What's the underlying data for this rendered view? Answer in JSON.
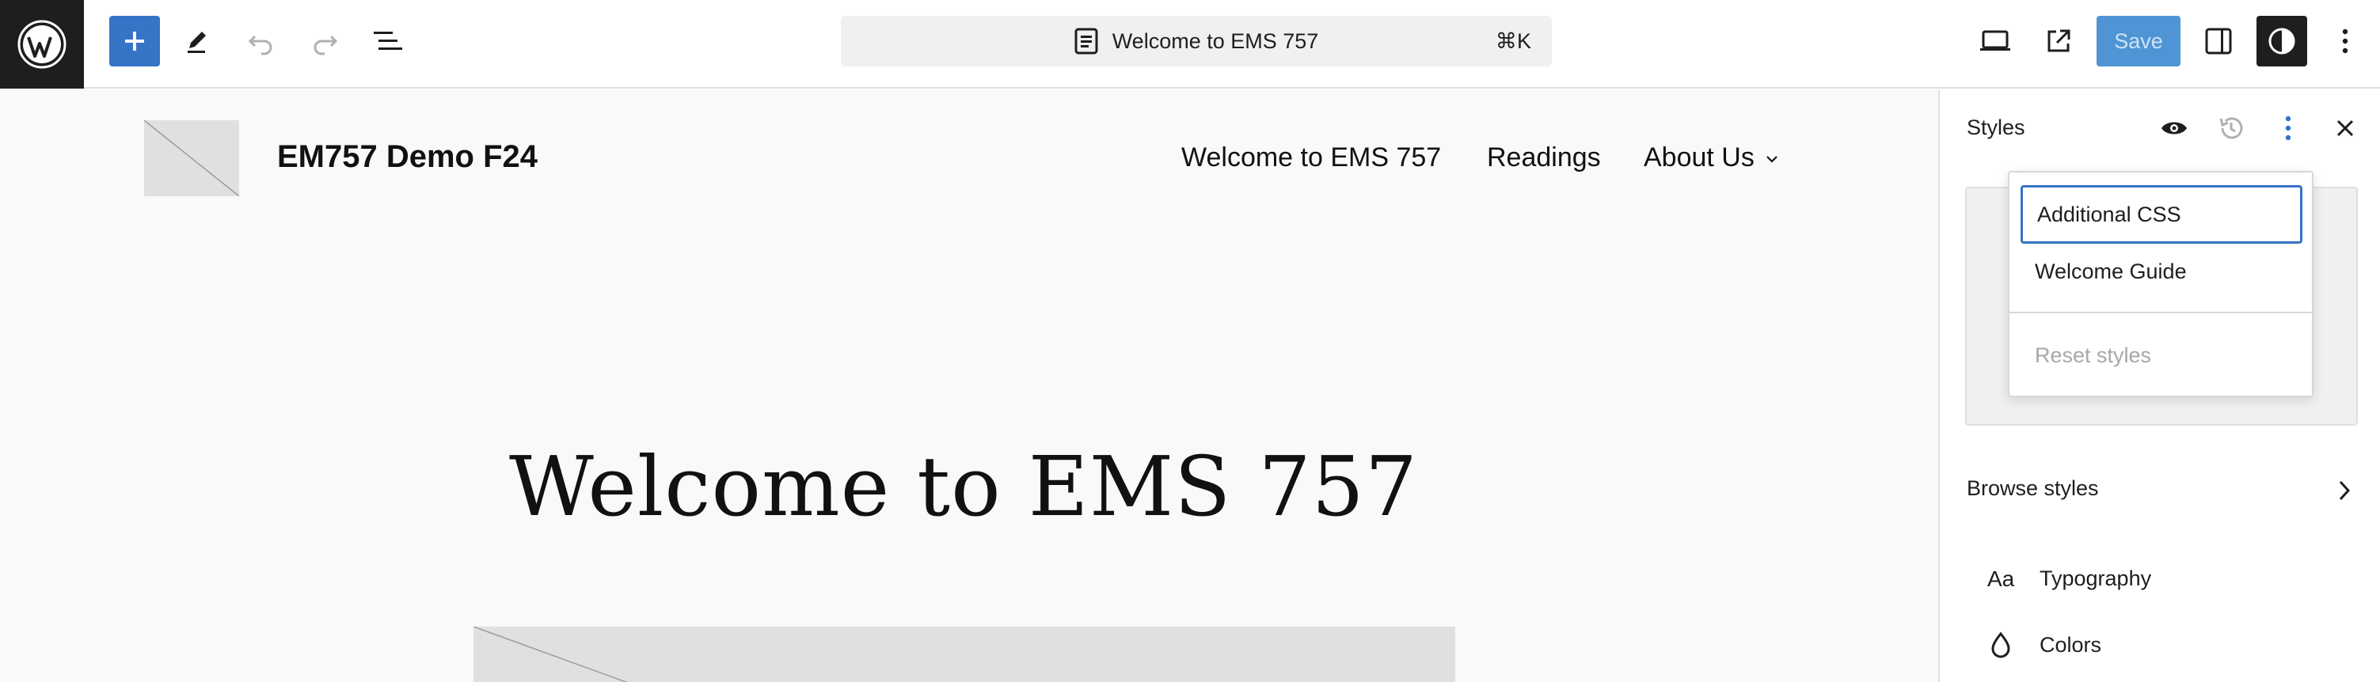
{
  "topbar": {
    "document_title": "Welcome to EMS 757",
    "shortcut": "⌘K",
    "save_label": "Save"
  },
  "canvas": {
    "site_title": "EM757 Demo F24",
    "nav": [
      "Welcome to EMS 757",
      "Readings",
      "About Us"
    ],
    "hero_title": "Welcome to EMS 757"
  },
  "sidebar": {
    "title": "Styles",
    "browse_label": "Browse styles",
    "items": [
      {
        "icon_text": "Aa",
        "label": "Typography"
      },
      {
        "icon_text": "",
        "label": "Colors"
      }
    ]
  },
  "menu": {
    "items": [
      "Additional CSS",
      "Welcome Guide"
    ],
    "reset_label": "Reset styles"
  },
  "colors": {
    "accent": "#3574c6",
    "save_bg": "#4f94d4",
    "dark": "#1e1e1e"
  }
}
